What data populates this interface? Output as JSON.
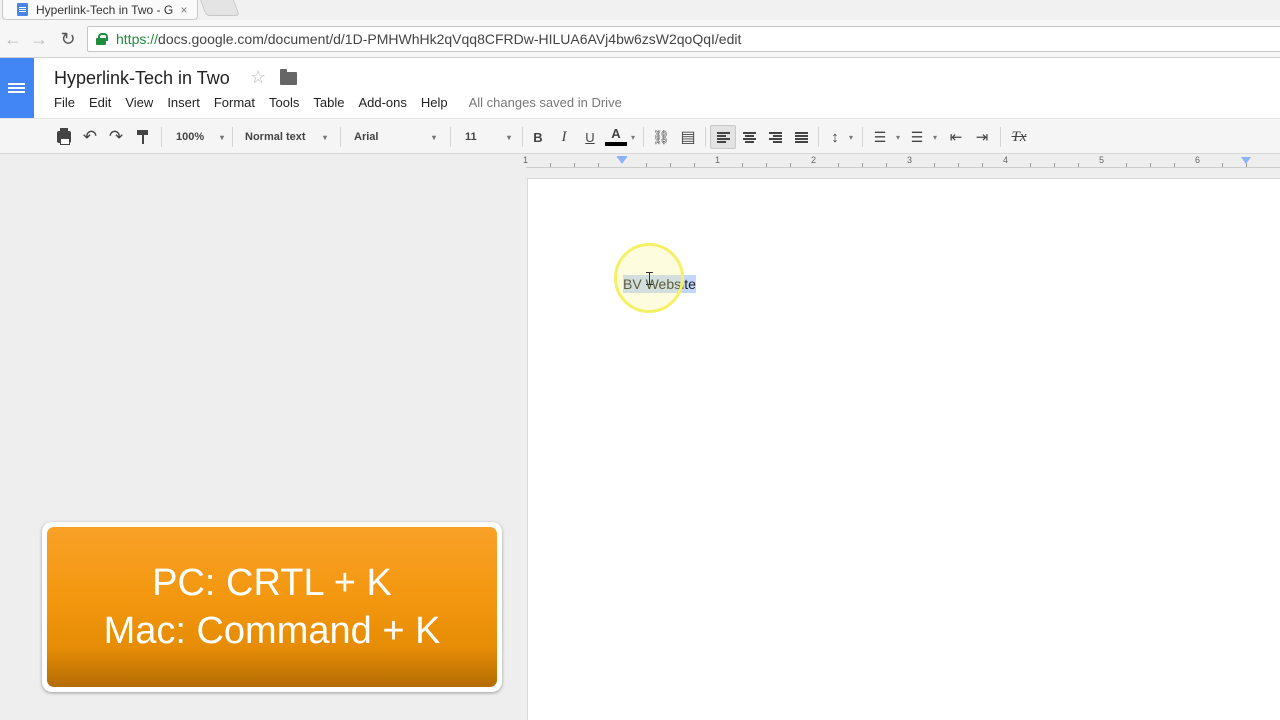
{
  "browser": {
    "tab_title": "Hyperlink-Tech in Two - G",
    "tab_close": "×",
    "url_scheme": "https://",
    "url_rest": "docs.google.com/document/d/1D-PMHWhHk2qVqq8CFRDw-HILUA6AVj4bw6zsW2qoQqI/edit",
    "back_glyph": "←",
    "forward_glyph": "→",
    "reload_glyph": "↻"
  },
  "docs": {
    "title": "Hyperlink-Tech in Two",
    "star_glyph": "☆",
    "menu": [
      "File",
      "Edit",
      "View",
      "Insert",
      "Format",
      "Tools",
      "Table",
      "Add-ons",
      "Help"
    ],
    "saved_status": "All changes saved in Drive"
  },
  "toolbar": {
    "undo_glyph": "↶",
    "redo_glyph": "↷",
    "zoom": "100%",
    "style": "Normal text",
    "font": "Arial",
    "size": "11",
    "bold": "B",
    "italic": "I",
    "underline": "U",
    "text_color_glyph": "A",
    "text_color": "#000000",
    "link_glyph": "⛓",
    "comment_glyph": "▤",
    "line_spacing_glyph": "↕",
    "numbered_list_glyph": "☰",
    "bulleted_list_glyph": "☰",
    "decrease_indent_glyph": "⇤",
    "increase_indent_glyph": "⇥",
    "clear_format_glyph": "Tx",
    "caret": "▾"
  },
  "ruler": {
    "labels": [
      "1",
      "1",
      "2",
      "3",
      "4",
      "5",
      "6"
    ]
  },
  "document": {
    "text": "BV Website",
    "selected": true
  },
  "callout": {
    "line1": "PC: CRTL + K",
    "line2": "Mac: Command + K",
    "colors": {
      "top": "#f9a127",
      "bottom": "#b46c03"
    }
  },
  "colors": {
    "docs_blue": "#4285f4",
    "secure_green": "#1e8e3e",
    "selection": "#c2d7fb",
    "highlight_ring": "#f6f067"
  }
}
